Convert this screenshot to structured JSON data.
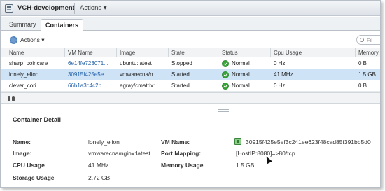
{
  "window": {
    "title": "VCH-development",
    "actions_label": "Actions ▾"
  },
  "tabs": [
    {
      "label": "Summary"
    },
    {
      "label": "Containers"
    }
  ],
  "toolbar": {
    "actions_label": "Actions ▾",
    "filter_placeholder": "Fil"
  },
  "grid": {
    "columns": [
      "Name",
      "VM Name",
      "Image",
      "State",
      "Status",
      "Cpu Usage",
      "Memory"
    ],
    "rows": [
      {
        "name": "sharp_poincare",
        "vm_name": "6e14fe723071...",
        "image": "ubuntu:latest",
        "state": "Stopped",
        "status": "Normal",
        "cpu": "0 Hz",
        "memory": "0 B"
      },
      {
        "name": "lonely_elion",
        "vm_name": "30915f425e5e...",
        "image": "vmwarecna/n...",
        "state": "Started",
        "status": "Normal",
        "cpu": "41 MHz",
        "memory": "1.5 GB"
      },
      {
        "name": "clever_cori",
        "vm_name": "66b1a3c4c2b...",
        "image": "egray/cmatrix:...",
        "state": "Started",
        "status": "Normal",
        "cpu": "0 Hz",
        "memory": "0 B"
      }
    ]
  },
  "detail": {
    "title": "Container Detail",
    "name_label": "Name:",
    "name_value": "lonely_elion",
    "image_label": "Image:",
    "image_value": "vmwarecna/nginx:latest",
    "cpu_label": "CPU Usage",
    "cpu_value": "41 MHz",
    "storage_label": "Storage Usage",
    "storage_value": "2.72 GB",
    "vm_name_label": "VM Name:",
    "vm_name_value": "30915f425e5ef3c241ee623f48cad85f391bb5d0",
    "port_label": "Port Mapping:",
    "port_value": "[HostIP:8080]=>80/tcp",
    "memory_label": "Memory Usage",
    "memory_value": "1.5 GB"
  },
  "colors": {
    "selection": "#cfe3f7",
    "link": "#1f5ea8",
    "status_normal": "#3aa639"
  },
  "icons": [
    "app-icon",
    "gear-icon",
    "search-icon",
    "status-normal-icon",
    "binoculars-icon",
    "vm-icon",
    "cursor-icon"
  ]
}
